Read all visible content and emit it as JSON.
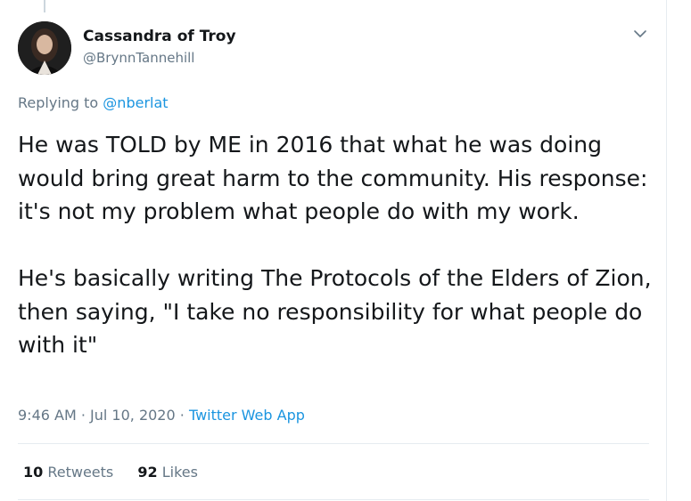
{
  "tweet": {
    "author_name": "Cassandra of Troy",
    "author_handle": "@BrynnTannehill",
    "replying_prefix": "Replying to",
    "replying_mention": "@nberlat",
    "paragraphs": [
      "He was TOLD by ME in 2016 that what he was doing would bring great harm to the community. His response: it's not my problem what people do with my work.",
      "He's basically writing The Protocols of the Elders of Zion, then saying, \"I take no responsibility for what people do with it\""
    ],
    "timestamp": "9:46 AM · Jul 10, 2020 ·",
    "source": "Twitter Web App",
    "retweets_count": "10",
    "retweets_label": "Retweets",
    "likes_count": "92",
    "likes_label": "Likes"
  },
  "icons": {
    "menu": "chevron-down-icon",
    "avatar": "avatar"
  },
  "colors": {
    "link": "#1b95e0",
    "secondary_text": "#657786",
    "primary_text": "#14171a",
    "divider": "#e6ecf0"
  }
}
